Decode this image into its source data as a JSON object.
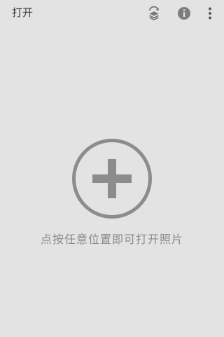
{
  "header": {
    "title": "打开",
    "actions": [
      {
        "icon": "layers-rotate-icon"
      },
      {
        "icon": "info-icon"
      },
      {
        "icon": "more-vert-icon"
      }
    ]
  },
  "main": {
    "add_icon": "add-circle-icon",
    "hint": "点按任意位置即可打开照片"
  },
  "colors": {
    "background": "#e3e3e3",
    "icon": "#8c8c8c",
    "title_text": "#3a3a3a",
    "hint_text": "#8a8a8a"
  }
}
